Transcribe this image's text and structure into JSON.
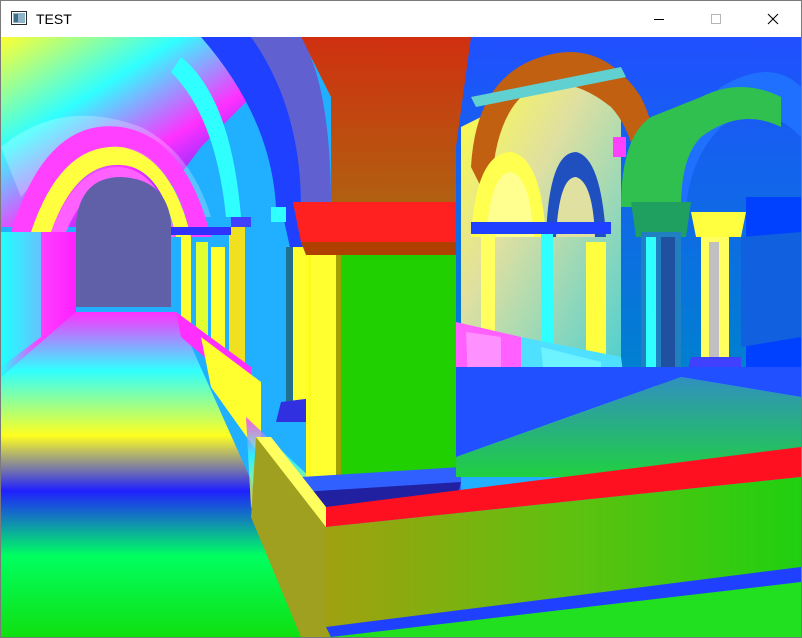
{
  "window": {
    "title": "TEST",
    "app_icon": "window-app-icon",
    "controls": {
      "minimize": "minimize-icon",
      "maximize": "maximize-icon",
      "close": "close-icon"
    }
  },
  "viewport": {
    "content": "3d-render-normal-shaded-scene"
  }
}
